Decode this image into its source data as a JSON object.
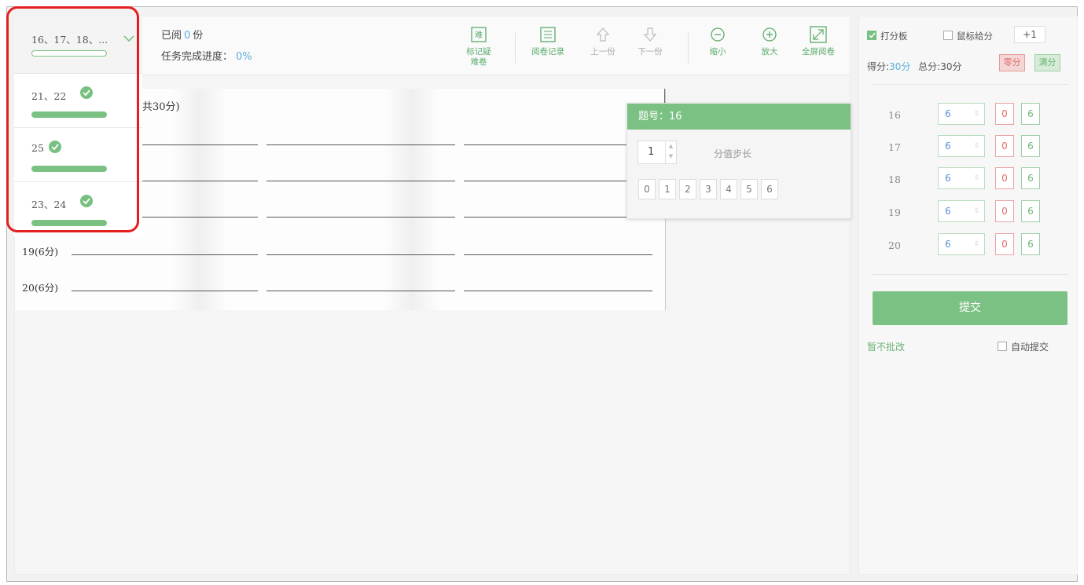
{
  "question_list": {
    "current": {
      "label": "16、17、18、...",
      "progress": 0
    },
    "items": [
      {
        "label": "21、22",
        "done": true,
        "progress": 1
      },
      {
        "label": "25",
        "done": true,
        "progress": 1
      },
      {
        "label": "23、24",
        "done": true,
        "progress": 1
      }
    ]
  },
  "status": {
    "reviewed_prefix": "已阅",
    "reviewed_count": "0",
    "reviewed_unit": "份",
    "progress_label": "任务完成进度：",
    "progress_value": "0%"
  },
  "toolbar": {
    "mark_doubt": "标记疑难卷",
    "mark_icon_text": "难",
    "history": "阅卷记录",
    "prev": "上一份",
    "next": "下一份",
    "zoom_out": "缩小",
    "zoom_in": "放大",
    "fullscreen": "全屏阅卷"
  },
  "paper": {
    "title_fragment": "共30分)",
    "rows": [
      "19(6分)",
      "20(6分)"
    ]
  },
  "popup": {
    "title": "题号：16",
    "step_value": "1",
    "step_label": "分值步长",
    "values": [
      "0",
      "1",
      "2",
      "3",
      "4",
      "5",
      "6"
    ]
  },
  "right_panel": {
    "score_board_label": "打分板",
    "score_board_checked": true,
    "mouse_score_label": "鼠标给分",
    "mouse_score_checked": false,
    "plus_one": "+1",
    "score_prefix": "得分:",
    "score_value": "30分",
    "total_label": "总分:30分",
    "zero_btn": "零分",
    "full_btn": "满分",
    "rows": [
      {
        "no": "16",
        "value": "6",
        "zero": "0",
        "full": "6"
      },
      {
        "no": "17",
        "value": "6",
        "zero": "0",
        "full": "6"
      },
      {
        "no": "18",
        "value": "6",
        "zero": "0",
        "full": "6"
      },
      {
        "no": "19",
        "value": "6",
        "zero": "0",
        "full": "6"
      },
      {
        "no": "20",
        "value": "6",
        "zero": "0",
        "full": "6"
      }
    ],
    "submit": "提交",
    "defer": "暂不批改",
    "auto_submit": "自动提交",
    "auto_submit_checked": false
  },
  "colors": {
    "accent_green": "#7cc184",
    "link_blue": "#5aaed8",
    "danger_red": "#e06a6a",
    "highlight_red": "#e41f1f"
  }
}
